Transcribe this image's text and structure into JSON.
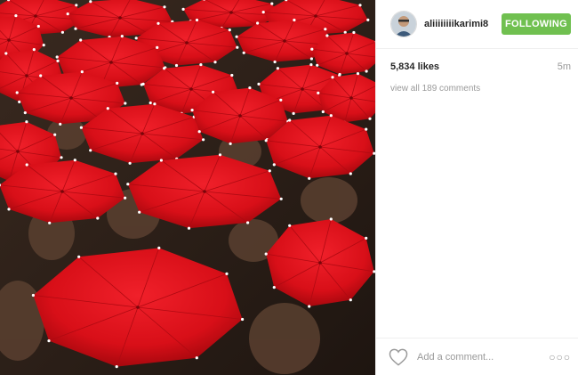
{
  "post": {
    "image_alt": "Crowd of people holding red umbrellas",
    "colors": {
      "umbrella": "#e0141c",
      "follow_button": "#70c050"
    }
  },
  "header": {
    "username": "aliiiiiiiikarimi8",
    "follow_label": "FOLLOWING"
  },
  "meta": {
    "likes": "5,834 likes",
    "time": "5m"
  },
  "comments": {
    "view_all": "view all 189 comments"
  },
  "footer": {
    "comment_placeholder": "Add a comment...",
    "more_icon": "more-options-icon",
    "like_icon": "heart-outline-icon"
  }
}
